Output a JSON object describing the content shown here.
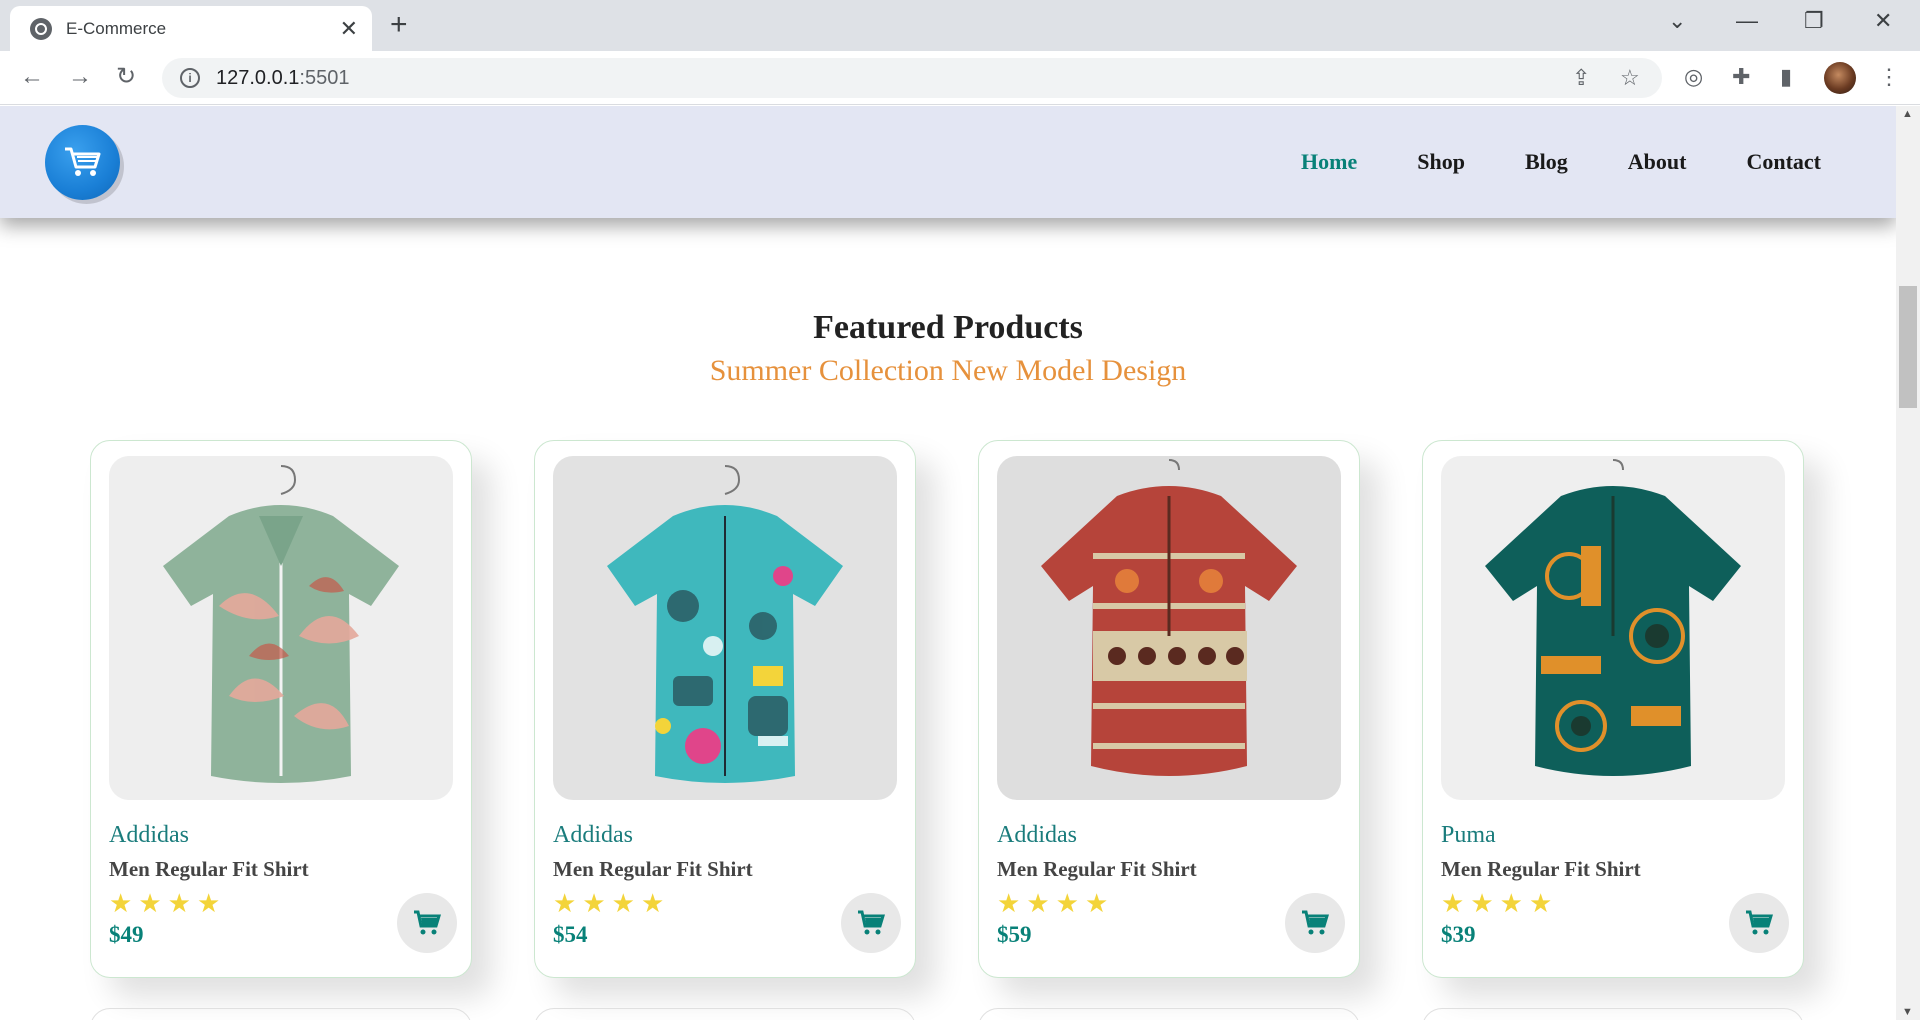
{
  "browser": {
    "tab_title": "E-Commerce",
    "url_host": "127.0.0.1",
    "url_port": ":5501"
  },
  "site": {
    "nav": [
      "Home",
      "Shop",
      "Blog",
      "About",
      "Contact"
    ],
    "active_nav": "Home"
  },
  "section": {
    "title": "Featured Products",
    "subtitle": "Summer Collection New Model Design"
  },
  "products": [
    {
      "brand": "Addidas",
      "name": "Men Regular Fit Shirt",
      "price": "$49",
      "rating": 4,
      "image": "floral-green-shirt",
      "colors": [
        "#8fb39b",
        "#e5a99b",
        "#c45a4a"
      ]
    },
    {
      "brand": "Addidas",
      "name": "Men Regular Fit Shirt",
      "price": "$54",
      "rating": 4,
      "image": "cartoon-teal-shirt",
      "colors": [
        "#3fb8bd",
        "#e0458a",
        "#1f2a33"
      ]
    },
    {
      "brand": "Addidas",
      "name": "Men Regular Fit Shirt",
      "price": "$59",
      "rating": 4,
      "image": "tribal-red-shirt",
      "colors": [
        "#b6443a",
        "#d8c9a6",
        "#5a2a20"
      ]
    },
    {
      "brand": "Puma",
      "name": "Men Regular Fit Shirt",
      "price": "$39",
      "rating": 4,
      "image": "mandala-teal-shirt",
      "colors": [
        "#0e5f5a",
        "#e0902a",
        "#1a3a30"
      ]
    }
  ],
  "colors": {
    "accent": "#088178",
    "header_bg": "#e3e6f3",
    "subtitle": "#e6913c",
    "star": "#f3d43a",
    "logo": "#1a7fd6"
  }
}
